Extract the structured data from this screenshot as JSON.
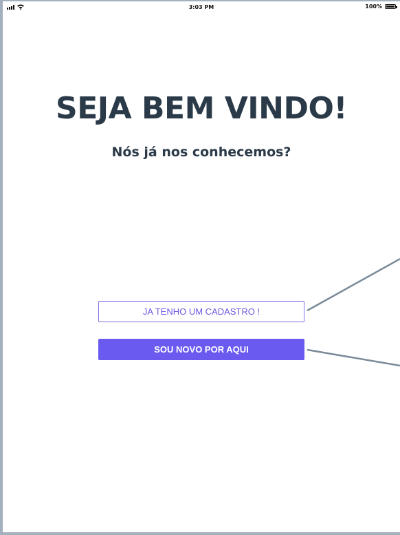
{
  "status_bar": {
    "time": "3:03 PM",
    "battery": "100%",
    "icons": [
      "signal-icon",
      "wifi-icon",
      "battery-icon"
    ]
  },
  "welcome": {
    "title": "SEJA BEM VINDO!",
    "subtitle": "Nós já nos conhecemos?"
  },
  "actions": {
    "existing_account_label": "JA TENHO UM CADASTRO !",
    "new_user_label": "SOU NOVO POR AQUI"
  },
  "colors": {
    "accent": "#6a5af0",
    "text": "#2b3a48",
    "connector": "#7a8a99"
  }
}
